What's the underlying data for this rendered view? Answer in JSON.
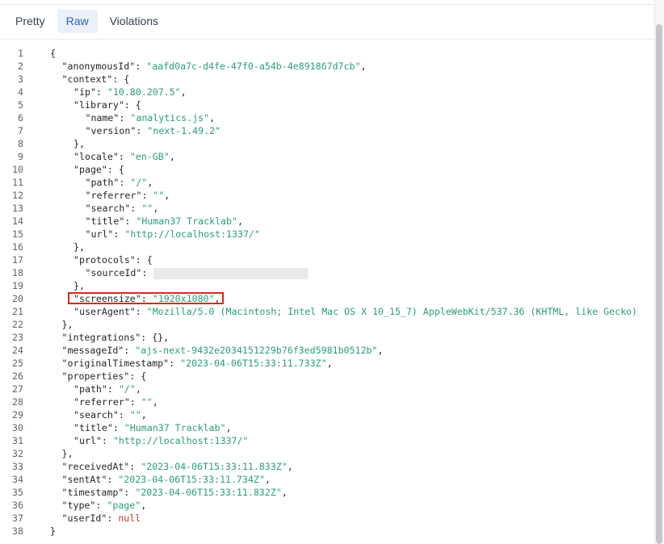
{
  "tabs": [
    {
      "label": "Pretty",
      "active": false
    },
    {
      "label": "Raw",
      "active": true
    },
    {
      "label": "Violations",
      "active": false
    }
  ],
  "lines": [
    {
      "n": "1",
      "indent": 0,
      "parts": [
        [
          "punc",
          "{"
        ]
      ]
    },
    {
      "n": "2",
      "indent": 1,
      "parts": [
        [
          "key",
          "\"anonymousId\""
        ],
        [
          "punc",
          ": "
        ],
        [
          "str",
          "\"aafd0a7c-d4fe-47f0-a54b-4e891867d7cb\""
        ],
        [
          "punc",
          ","
        ]
      ]
    },
    {
      "n": "3",
      "indent": 1,
      "parts": [
        [
          "key",
          "\"context\""
        ],
        [
          "punc",
          ": {"
        ]
      ]
    },
    {
      "n": "4",
      "indent": 2,
      "parts": [
        [
          "key",
          "\"ip\""
        ],
        [
          "punc",
          ": "
        ],
        [
          "str",
          "\"10.80.207.5\""
        ],
        [
          "punc",
          ","
        ]
      ]
    },
    {
      "n": "5",
      "indent": 2,
      "parts": [
        [
          "key",
          "\"library\""
        ],
        [
          "punc",
          ": {"
        ]
      ]
    },
    {
      "n": "6",
      "indent": 3,
      "parts": [
        [
          "key",
          "\"name\""
        ],
        [
          "punc",
          ": "
        ],
        [
          "str",
          "\"analytics.js\""
        ],
        [
          "punc",
          ","
        ]
      ]
    },
    {
      "n": "7",
      "indent": 3,
      "parts": [
        [
          "key",
          "\"version\""
        ],
        [
          "punc",
          ": "
        ],
        [
          "str",
          "\"next-1.49.2\""
        ]
      ]
    },
    {
      "n": "8",
      "indent": 2,
      "parts": [
        [
          "punc",
          "},"
        ]
      ]
    },
    {
      "n": "9",
      "indent": 2,
      "parts": [
        [
          "key",
          "\"locale\""
        ],
        [
          "punc",
          ": "
        ],
        [
          "str",
          "\"en-GB\""
        ],
        [
          "punc",
          ","
        ]
      ]
    },
    {
      "n": "10",
      "indent": 2,
      "parts": [
        [
          "key",
          "\"page\""
        ],
        [
          "punc",
          ": {"
        ]
      ]
    },
    {
      "n": "11",
      "indent": 3,
      "parts": [
        [
          "key",
          "\"path\""
        ],
        [
          "punc",
          ": "
        ],
        [
          "str",
          "\"/\""
        ],
        [
          "punc",
          ","
        ]
      ]
    },
    {
      "n": "12",
      "indent": 3,
      "parts": [
        [
          "key",
          "\"referrer\""
        ],
        [
          "punc",
          ": "
        ],
        [
          "str",
          "\"\""
        ],
        [
          "punc",
          ","
        ]
      ]
    },
    {
      "n": "13",
      "indent": 3,
      "parts": [
        [
          "key",
          "\"search\""
        ],
        [
          "punc",
          ": "
        ],
        [
          "str",
          "\"\""
        ],
        [
          "punc",
          ","
        ]
      ]
    },
    {
      "n": "14",
      "indent": 3,
      "parts": [
        [
          "key",
          "\"title\""
        ],
        [
          "punc",
          ": "
        ],
        [
          "str",
          "\"Human37 Tracklab\""
        ],
        [
          "punc",
          ","
        ]
      ]
    },
    {
      "n": "15",
      "indent": 3,
      "parts": [
        [
          "key",
          "\"url\""
        ],
        [
          "punc",
          ": "
        ],
        [
          "str",
          "\"http://localhost:1337/\""
        ]
      ]
    },
    {
      "n": "16",
      "indent": 2,
      "parts": [
        [
          "punc",
          "},"
        ]
      ]
    },
    {
      "n": "17",
      "indent": 2,
      "parts": [
        [
          "key",
          "\"protocols\""
        ],
        [
          "punc",
          ": {"
        ]
      ]
    },
    {
      "n": "18",
      "indent": 3,
      "parts": [
        [
          "key",
          "\"sourceId\""
        ],
        [
          "punc",
          ":"
        ]
      ],
      "redacted": true
    },
    {
      "n": "19",
      "indent": 2,
      "parts": [
        [
          "punc",
          "},"
        ]
      ]
    },
    {
      "n": "20",
      "indent": 2,
      "parts": [
        [
          "key",
          "\"screensize\""
        ],
        [
          "punc",
          ": "
        ],
        [
          "str",
          "\"1920x1080\""
        ],
        [
          "punc",
          ","
        ]
      ]
    },
    {
      "n": "21",
      "indent": 2,
      "parts": [
        [
          "key",
          "\"userAgent\""
        ],
        [
          "punc",
          ": "
        ],
        [
          "str",
          "\"Mozilla/5.0 (Macintosh; Intel Mac OS X 10_15_7) AppleWebKit/537.36 (KHTML, like Gecko)"
        ]
      ]
    },
    {
      "n": "22",
      "indent": 1,
      "parts": [
        [
          "punc",
          "},"
        ]
      ]
    },
    {
      "n": "23",
      "indent": 1,
      "parts": [
        [
          "key",
          "\"integrations\""
        ],
        [
          "punc",
          ": {},"
        ]
      ]
    },
    {
      "n": "24",
      "indent": 1,
      "parts": [
        [
          "key",
          "\"messageId\""
        ],
        [
          "punc",
          ": "
        ],
        [
          "str",
          "\"ajs-next-9432e2034151229b76f3ed5981b0512b\""
        ],
        [
          "punc",
          ","
        ]
      ]
    },
    {
      "n": "25",
      "indent": 1,
      "parts": [
        [
          "key",
          "\"originalTimestamp\""
        ],
        [
          "punc",
          ": "
        ],
        [
          "str",
          "\"2023-04-06T15:33:11.733Z\""
        ],
        [
          "punc",
          ","
        ]
      ]
    },
    {
      "n": "26",
      "indent": 1,
      "parts": [
        [
          "key",
          "\"properties\""
        ],
        [
          "punc",
          ": {"
        ]
      ]
    },
    {
      "n": "27",
      "indent": 2,
      "parts": [
        [
          "key",
          "\"path\""
        ],
        [
          "punc",
          ": "
        ],
        [
          "str",
          "\"/\""
        ],
        [
          "punc",
          ","
        ]
      ]
    },
    {
      "n": "28",
      "indent": 2,
      "parts": [
        [
          "key",
          "\"referrer\""
        ],
        [
          "punc",
          ": "
        ],
        [
          "str",
          "\"\""
        ],
        [
          "punc",
          ","
        ]
      ]
    },
    {
      "n": "29",
      "indent": 2,
      "parts": [
        [
          "key",
          "\"search\""
        ],
        [
          "punc",
          ": "
        ],
        [
          "str",
          "\"\""
        ],
        [
          "punc",
          ","
        ]
      ]
    },
    {
      "n": "30",
      "indent": 2,
      "parts": [
        [
          "key",
          "\"title\""
        ],
        [
          "punc",
          ": "
        ],
        [
          "str",
          "\"Human37 Tracklab\""
        ],
        [
          "punc",
          ","
        ]
      ]
    },
    {
      "n": "31",
      "indent": 2,
      "parts": [
        [
          "key",
          "\"url\""
        ],
        [
          "punc",
          ": "
        ],
        [
          "str",
          "\"http://localhost:1337/\""
        ]
      ]
    },
    {
      "n": "32",
      "indent": 1,
      "parts": [
        [
          "punc",
          "},"
        ]
      ]
    },
    {
      "n": "33",
      "indent": 1,
      "parts": [
        [
          "key",
          "\"receivedAt\""
        ],
        [
          "punc",
          ": "
        ],
        [
          "str",
          "\"2023-04-06T15:33:11.833Z\""
        ],
        [
          "punc",
          ","
        ]
      ]
    },
    {
      "n": "34",
      "indent": 1,
      "parts": [
        [
          "key",
          "\"sentAt\""
        ],
        [
          "punc",
          ": "
        ],
        [
          "str",
          "\"2023-04-06T15:33:11.734Z\""
        ],
        [
          "punc",
          ","
        ]
      ]
    },
    {
      "n": "35",
      "indent": 1,
      "parts": [
        [
          "key",
          "\"timestamp\""
        ],
        [
          "punc",
          ": "
        ],
        [
          "str",
          "\"2023-04-06T15:33:11.832Z\""
        ],
        [
          "punc",
          ","
        ]
      ]
    },
    {
      "n": "36",
      "indent": 1,
      "parts": [
        [
          "key",
          "\"type\""
        ],
        [
          "punc",
          ": "
        ],
        [
          "str",
          "\"page\""
        ],
        [
          "punc",
          ","
        ]
      ]
    },
    {
      "n": "37",
      "indent": 1,
      "parts": [
        [
          "key",
          "\"userId\""
        ],
        [
          "punc",
          ": "
        ],
        [
          "null",
          "null"
        ]
      ]
    },
    {
      "n": "38",
      "indent": 0,
      "parts": [
        [
          "punc",
          "}"
        ]
      ]
    }
  ],
  "highlight_line": "20",
  "colors": {
    "string": "#2a9d78",
    "null": "#c0392b",
    "highlight_border": "#e0251b",
    "active_tab_bg": "#eaf1fb",
    "active_tab_text": "#2a62b8"
  }
}
